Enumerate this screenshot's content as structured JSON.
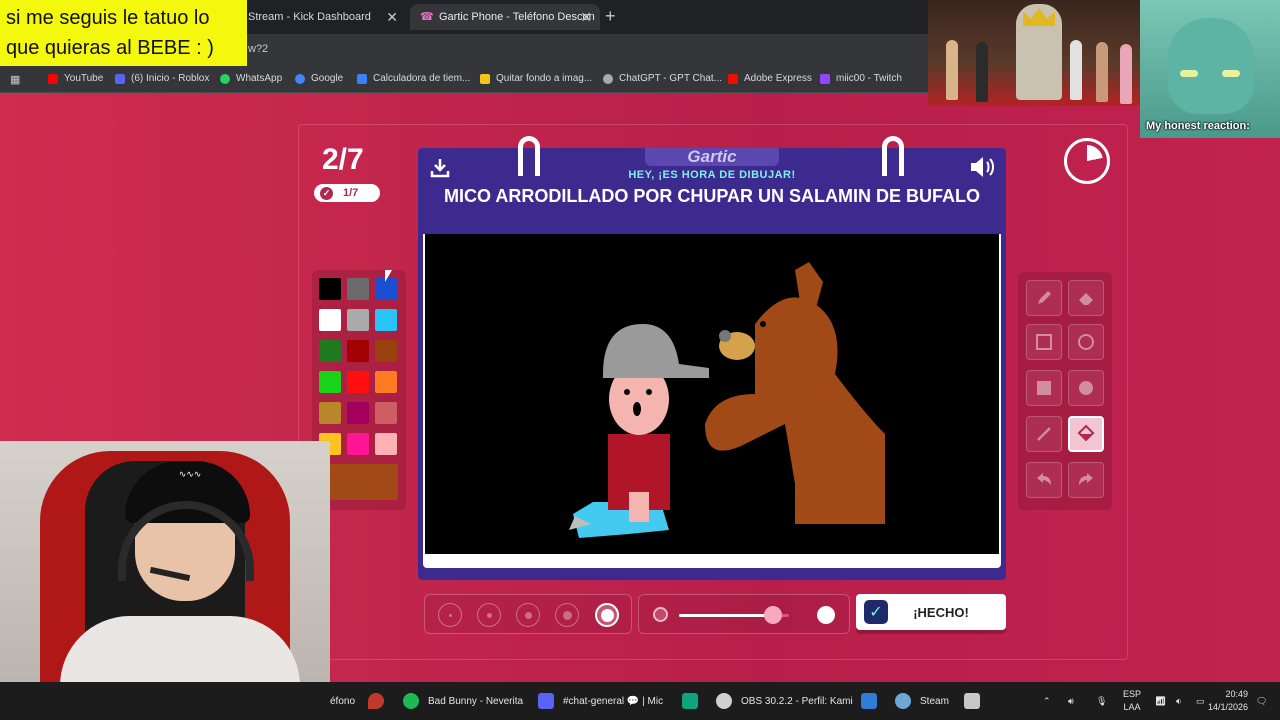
{
  "overlay": {
    "text": "si me seguis le tatuo lo que quieras al BEBE : )"
  },
  "browser": {
    "tabs": [
      {
        "label": "Stream - Kick Dashboard"
      },
      {
        "label": "Gartic Phone - Teléfono Descon"
      }
    ],
    "url_fragment": "w?2",
    "bookmarks": [
      {
        "label": "YouTube",
        "color": "#ff0000"
      },
      {
        "label": "(6) Inicio - Roblox",
        "color": "#5865f2"
      },
      {
        "label": "WhatsApp",
        "color": "#25d366"
      },
      {
        "label": "Google",
        "color": "#4285f4"
      },
      {
        "label": "Calculadora de tiem...",
        "color": "#3b82f6"
      },
      {
        "label": "Quitar fondo a imag...",
        "color": "#f5c518"
      },
      {
        "label": "ChatGPT - GPT Chat...",
        "color": "#aaaaaa"
      },
      {
        "label": "Adobe Express",
        "color": "#eb1000"
      },
      {
        "label": "miic00 - Twitch",
        "color": "#9146ff"
      }
    ]
  },
  "game": {
    "round": "2/7",
    "round_badge": "1/7",
    "logo": "Gartic",
    "subheading": "HEY, ¡ES HORA DE DIBUJAR!",
    "prompt": "MICO ARRODILLADO POR CHUPAR UN SALAMIN DE BUFALO",
    "done_label": "¡HECHO!",
    "timer_progress": 0.22,
    "opacity_level": 0.85,
    "selected_brush_size": 5,
    "current_color": "#a14a17",
    "palette": [
      "#000000",
      "#6b6b6b",
      "#1a4fd1",
      "#ffffff",
      "#aaaaaa",
      "#27c4f5",
      "#1f7a1f",
      "#a30000",
      "#98410f",
      "#19d319",
      "#ff0f0f",
      "#ff7a22",
      "#b8872a",
      "#a3005e",
      "#cc5e64",
      "#ffc31f",
      "#ff1493",
      "#ffb1b4"
    ],
    "tools": [
      "pencil-icon",
      "eraser-icon",
      "rectangle-outline-icon",
      "ellipse-outline-icon",
      "rectangle-filled-icon",
      "ellipse-filled-icon",
      "line-icon",
      "bucket-fill-icon",
      "undo-icon",
      "redo-icon"
    ],
    "selected_tool": "bucket-fill-icon"
  },
  "webcam_overlay": {
    "caption": "My honest reaction:"
  },
  "taskbar": {
    "items": [
      {
        "label": "éfono",
        "color": "#f2a900"
      },
      {
        "label": "",
        "color": "#c0392b"
      },
      {
        "label": "Bad Bunny - Neverita",
        "color": "#1db954"
      },
      {
        "label": "#chat-general 💬 | Mic",
        "color": "#5865f2"
      },
      {
        "label": "",
        "color": "#10a37f"
      },
      {
        "label": "OBS 30.2.2 - Perfil: Kami",
        "color": "#d0d0d0"
      },
      {
        "label": "",
        "color": "#2f7bd6"
      },
      {
        "label": "Steam",
        "color": "#6ca7d8"
      },
      {
        "label": "",
        "color": "#c8c8c8"
      }
    ],
    "language": "ESP",
    "layout": "LAA",
    "time": "20:49",
    "date": "14/1/2026"
  }
}
